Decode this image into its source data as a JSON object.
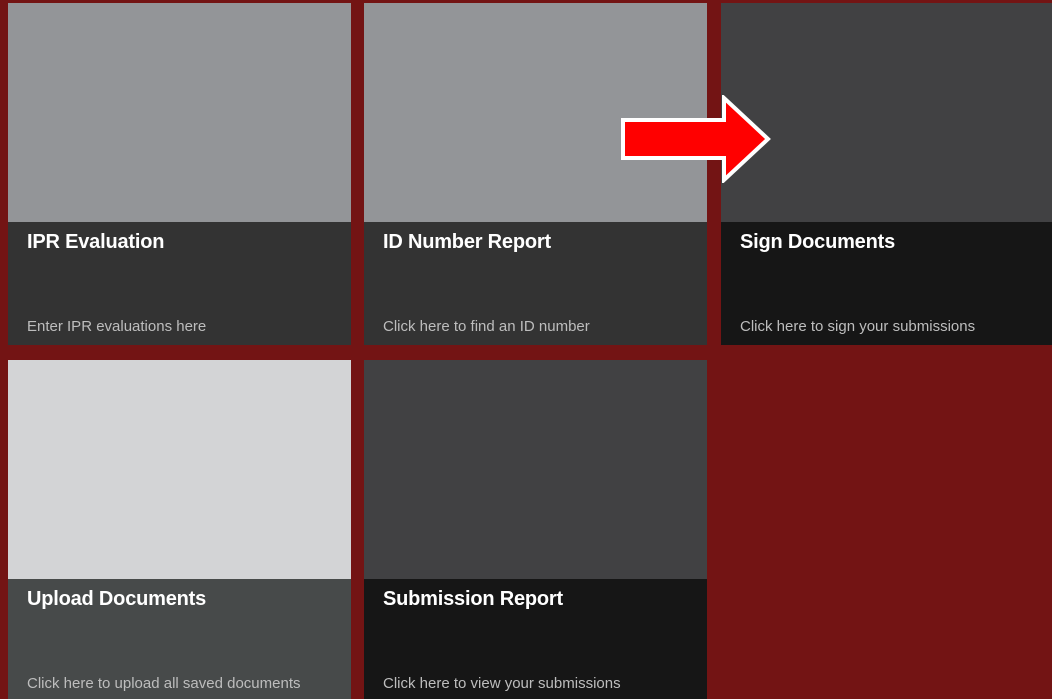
{
  "tiles": [
    {
      "title": "IPR Evaluation",
      "description": "Enter IPR evaluations here"
    },
    {
      "title": "ID Number Report",
      "description": "Click here to find an ID number"
    },
    {
      "title": "Sign Documents",
      "description": "Click here to sign your submissions"
    },
    {
      "title": "Upload Documents",
      "description": "Click here to upload all saved documents"
    },
    {
      "title": "Submission Report",
      "description": "Click here to view your submissions"
    }
  ],
  "colors": {
    "background": "#731414",
    "arrow_fill": "#ff0000",
    "arrow_outline": "#ffffff"
  },
  "icons": {
    "annotation": "right-arrow-icon"
  }
}
